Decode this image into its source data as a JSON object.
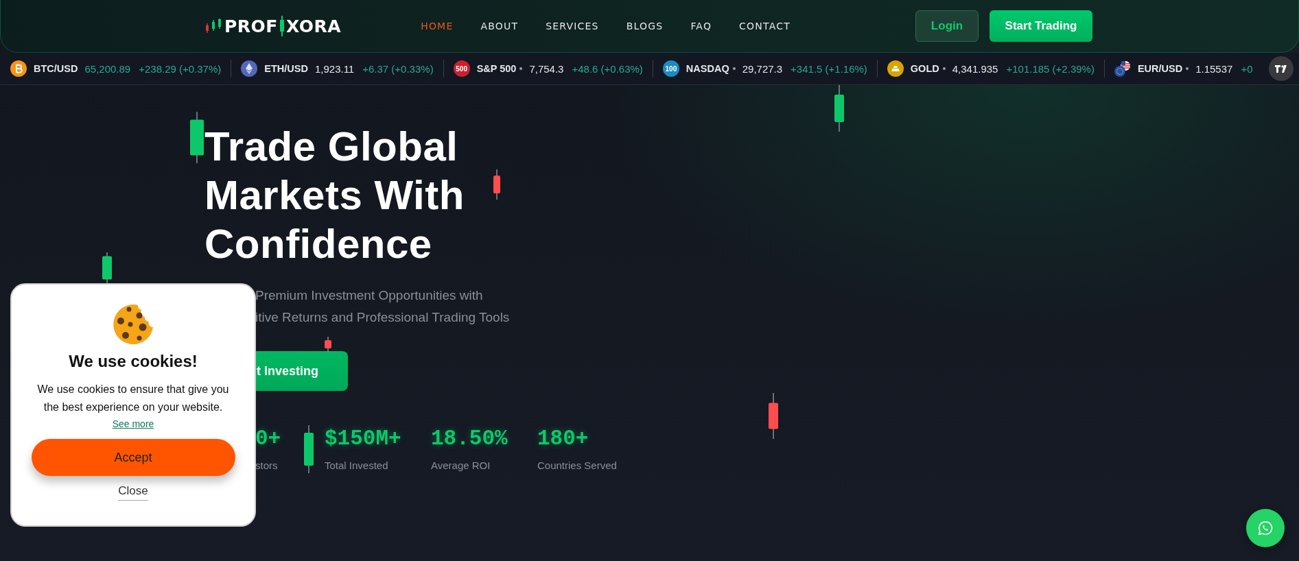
{
  "header": {
    "logo": {
      "text_before": "PROF",
      "text_after": "XORA"
    },
    "nav": [
      {
        "label": "HOME",
        "selected": true
      },
      {
        "label": "ABOUT",
        "selected": false
      },
      {
        "label": "SERVICES",
        "selected": false
      },
      {
        "label": "BLOGS",
        "selected": false
      },
      {
        "label": "FAQ",
        "selected": false
      },
      {
        "label": "CONTACT",
        "selected": false
      }
    ],
    "buttons": [
      {
        "label": "Login",
        "kind": "outline"
      },
      {
        "label": "Start Trading",
        "kind": "solid"
      }
    ]
  },
  "ticker": [
    {
      "symbol": "BTC/USD",
      "color": "#f7931a",
      "price": "65,200.89",
      "price_up": true,
      "change": "+238.29 (+0.37%)",
      "dot": false
    },
    {
      "symbol": "ETH/USD",
      "color": "#5468b8",
      "price": "1,923.11",
      "price_up": false,
      "change": "+6.37 (+0.33%)",
      "dot": false
    },
    {
      "symbol": "S&P 500",
      "badge": "500",
      "color": "#cc1f2f",
      "price": "7,754.3",
      "price_up": false,
      "change": "+48.6 (+0.63%)",
      "dot": true
    },
    {
      "symbol": "NASDAQ",
      "badge": "100",
      "color": "#1a8cc4",
      "price": "29,727.3",
      "price_up": false,
      "change": "+341.5 (+1.16%)",
      "dot": true
    },
    {
      "symbol": "GOLD",
      "color": "#d9a400",
      "price": "4,341.935",
      "price_up": false,
      "change": "+101.185 (+2.39%)",
      "dot": true
    },
    {
      "symbol": "EUR/USD",
      "color": "#1f4fb5",
      "price": "1.15537",
      "price_up": false,
      "change": "+0",
      "dot": true
    }
  ],
  "hero": {
    "title_lines": [
      "Trade Global",
      "Markets With",
      "Confidence"
    ],
    "subtitle_lines": [
      "Premium Investment Opportunities with",
      "itive Returns and Professional Trading Tools"
    ],
    "cta": "t Investing",
    "stats": [
      {
        "value": "0+",
        "label": "stors"
      },
      {
        "value": "$150M+",
        "label": "Total Invested"
      },
      {
        "value": "18.50%",
        "label": "Average ROI"
      },
      {
        "value": "180+",
        "label": "Countries Served"
      }
    ]
  },
  "cookie_popup": {
    "title": "We use cookies!",
    "text": "We use cookies to ensure that give you the best experience on your website.",
    "link": "See more",
    "accept": "Accept",
    "close": "Close"
  }
}
